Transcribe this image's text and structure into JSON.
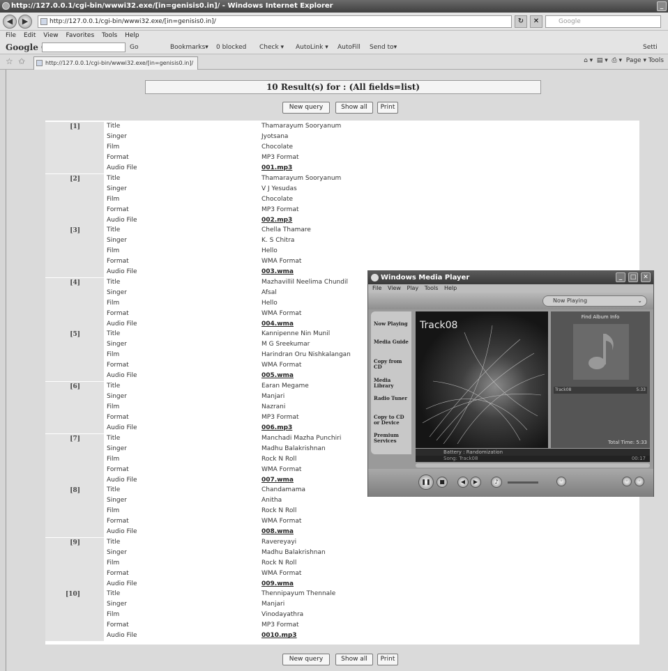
{
  "browser": {
    "window_title": "http://127.0.0.1/cgi-bin/wwwi32.exe/[in=genisis0.in]/ - Windows Internet Explorer",
    "address": "http://127.0.0.1/cgi-bin/wwwi32.exe/[in=genisis0.in]/",
    "search_placeholder": "Google",
    "menu": [
      "File",
      "Edit",
      "View",
      "Favorites",
      "Tools",
      "Help"
    ],
    "google_toolbar": {
      "logo": "Google G-",
      "items": [
        "Go",
        "Bookmarks▾",
        "0 blocked",
        "Check ▾",
        "AutoLink ▾",
        "AutoFill",
        "Send to▾"
      ],
      "settings": "Setti"
    },
    "tab_label": "http://127.0.0.1/cgi-bin/wwwi32.exe/[in=genisis0.in]/",
    "tab_tools": "Page ▾   Tools"
  },
  "page": {
    "result_header": "10 Result(s) for : (All fields=list)",
    "buttons": {
      "new_query": "New query",
      "show_all": "Show all",
      "print": "Print"
    },
    "field_labels": [
      "Title",
      "Singer",
      "Film",
      "Format",
      "Audio File"
    ],
    "records": [
      {
        "num": "[1]",
        "title": "Thamarayum Sooryanum",
        "singer": "Jyotsana",
        "film": "Chocolate",
        "format": "MP3 Format",
        "file": "001.mp3"
      },
      {
        "num": "[2]",
        "title": "Thamarayum Sooryanum",
        "singer": "V J Yesudas",
        "film": "Chocolate",
        "format": "MP3 Format",
        "file": "002.mp3"
      },
      {
        "num": "[3]",
        "title": "Chella Thamare",
        "singer": "K. S Chitra",
        "film": "Hello",
        "format": "WMA Format",
        "file": "003.wma"
      },
      {
        "num": "[4]",
        "title": "Mazhavillil Neelima Chundil",
        "singer": "Afsal",
        "film": "Hello",
        "format": "WMA Format",
        "file": "004.wma"
      },
      {
        "num": "[5]",
        "title": "Kannipenne Nin Munil",
        "singer": "M G Sreekumar",
        "film": "Harindran Oru Nishkalangan",
        "format": "WMA Format",
        "file": "005.wma"
      },
      {
        "num": "[6]",
        "title": "Earan Megame",
        "singer": "Manjari",
        "film": "Nazrani",
        "format": "MP3 Format",
        "file": "006.mp3"
      },
      {
        "num": "[7]",
        "title": "Manchadi Mazha Punchiri",
        "singer": "Madhu Balakrishnan",
        "film": "Rock N Roll",
        "format": "WMA Format",
        "file": "007.wma"
      },
      {
        "num": "[8]",
        "title": "Chandamama",
        "singer": "Anitha",
        "film": "Rock N Roll",
        "format": "WMA Format",
        "file": "008.wma"
      },
      {
        "num": "[9]",
        "title": "Ravereyayi",
        "singer": "Madhu Balakrishnan",
        "film": "Rock N Roll",
        "format": "WMA Format",
        "file": "009.wma"
      },
      {
        "num": "[10]",
        "title": "Thennipayum Thennale",
        "singer": "Manjari",
        "film": "Vinodayathra",
        "format": "MP3 Format",
        "file": "0010.mp3"
      }
    ]
  },
  "media_player": {
    "title": "Windows Media Player",
    "menu": [
      "File",
      "View",
      "Play",
      "Tools",
      "Help"
    ],
    "now_playing_dropdown": "Now Playing",
    "sidebar": [
      "Now Playing",
      "Media Guide",
      "Copy from CD",
      "Media Library",
      "Radio Tuner",
      "Copy to CD or Device",
      "Premium Services"
    ],
    "track_name": "Track08",
    "find_album_info": "Find Album Info",
    "playlist_row": {
      "name": "Track08",
      "time": "5:33"
    },
    "total_time": "Total Time: 5:33",
    "visualization": "Battery : Randomization",
    "song_status": "Song: Track08",
    "elapsed": "00:17"
  }
}
